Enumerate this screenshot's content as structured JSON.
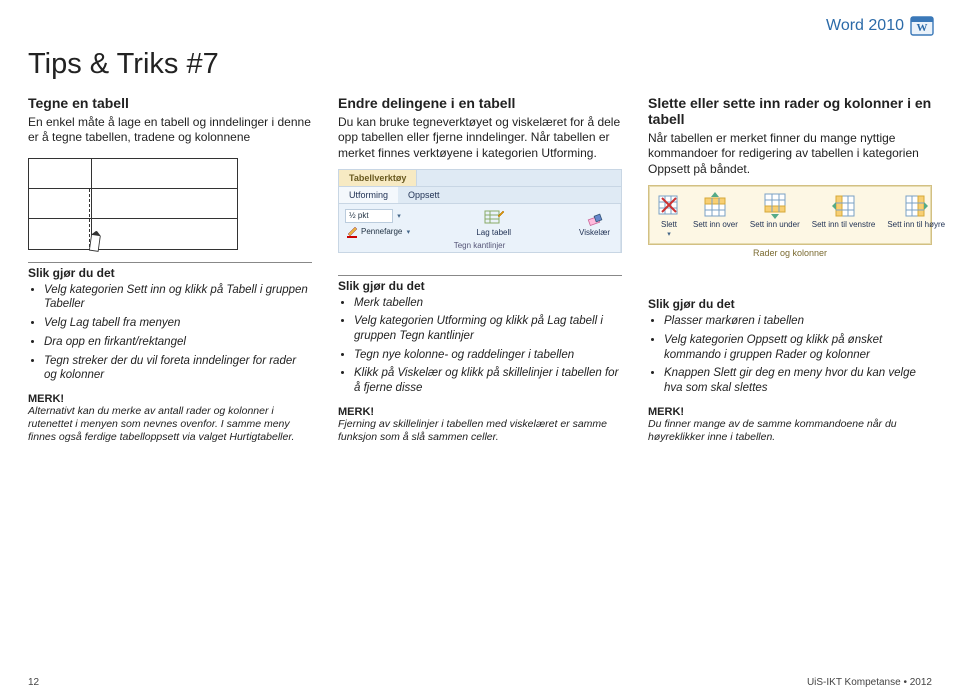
{
  "header": {
    "product": "Word 2010"
  },
  "page_title": "Tips & Triks #7",
  "col1": {
    "heading": "Tegne en tabell",
    "intro": "En enkel måte å lage en tabell og inndelinger i denne er å tegne tabellen, tradene og kolonnene",
    "instr_h": "Slik gjør du det",
    "bullets": [
      "Velg kategorien Sett inn og klikk på Tabell i gruppen Tabeller",
      "Velg Lag tabell fra menyen",
      "Dra opp en firkant/rektangel",
      "Tegn streker der du vil foreta inndelinger for rader og kolonner"
    ],
    "note_h": "MERK!",
    "note": "Alternativt kan du merke av antall rader og kolonner i rutenettet i menyen som nevnes ovenfor. I samme meny finnes også ferdige tabelloppsett via valget Hurtigtabeller."
  },
  "col2": {
    "heading": "Endre delingene i en tabell",
    "intro": "Du kan bruke tegneverktøyet og viskelæret for å dele opp tabellen eller fjerne inndelinger. Når tabellen er merket finnes verktøyene i kategorien Utforming.",
    "ribbon": {
      "title_tab": "Tabellverktøy",
      "tabs": [
        "Utforming",
        "Oppsett"
      ],
      "line_weight": "½ pkt",
      "pen_color": "Pennefarge",
      "draw_btn": "Lag tabell",
      "erase_btn": "Viskelær",
      "group_label": "Tegn kantlinjer"
    },
    "instr_h": "Slik gjør du det",
    "bullets": [
      "Merk tabellen",
      "Velg kategorien Utforming og klikk på Lag tabell i gruppen Tegn kantlinjer",
      "Tegn nye kolonne- og raddelinger i tabellen",
      "Klikk på Viskelær og klikk på skillelinjer i tabellen for å fjerne disse"
    ],
    "note_h": "MERK!",
    "note": "Fjerning av skillelinjer i tabellen med viskelæret er samme funksjon som å slå sammen celler."
  },
  "col3": {
    "heading": "Slette eller sette inn rader og kolonner i en tabell",
    "intro": "Når tabellen er merket finner du mange nyttige kommandoer for redigering av tabellen i kategorien Oppsett på båndet.",
    "rc": {
      "delete": "Slett",
      "ins_above": "Sett inn over",
      "ins_below": "Sett inn under",
      "ins_left": "Sett inn til venstre",
      "ins_right": "Sett inn til høyre",
      "group_label": "Rader og kolonner"
    },
    "instr_h": "Slik gjør du det",
    "bullets": [
      "Plasser markøren i tabellen",
      "Velg kategorien Oppsett og klikk på ønsket kommando i gruppen Rader og kolonner",
      "Knappen Slett gir deg en meny hvor du kan velge hva som skal slettes"
    ],
    "note_h": "MERK!",
    "note": "Du finner mange av de samme kommandoene når du høyreklikker inne i tabellen."
  },
  "footer": {
    "page": "12",
    "credit": "UiS-IKT Kompetanse • 2012"
  }
}
